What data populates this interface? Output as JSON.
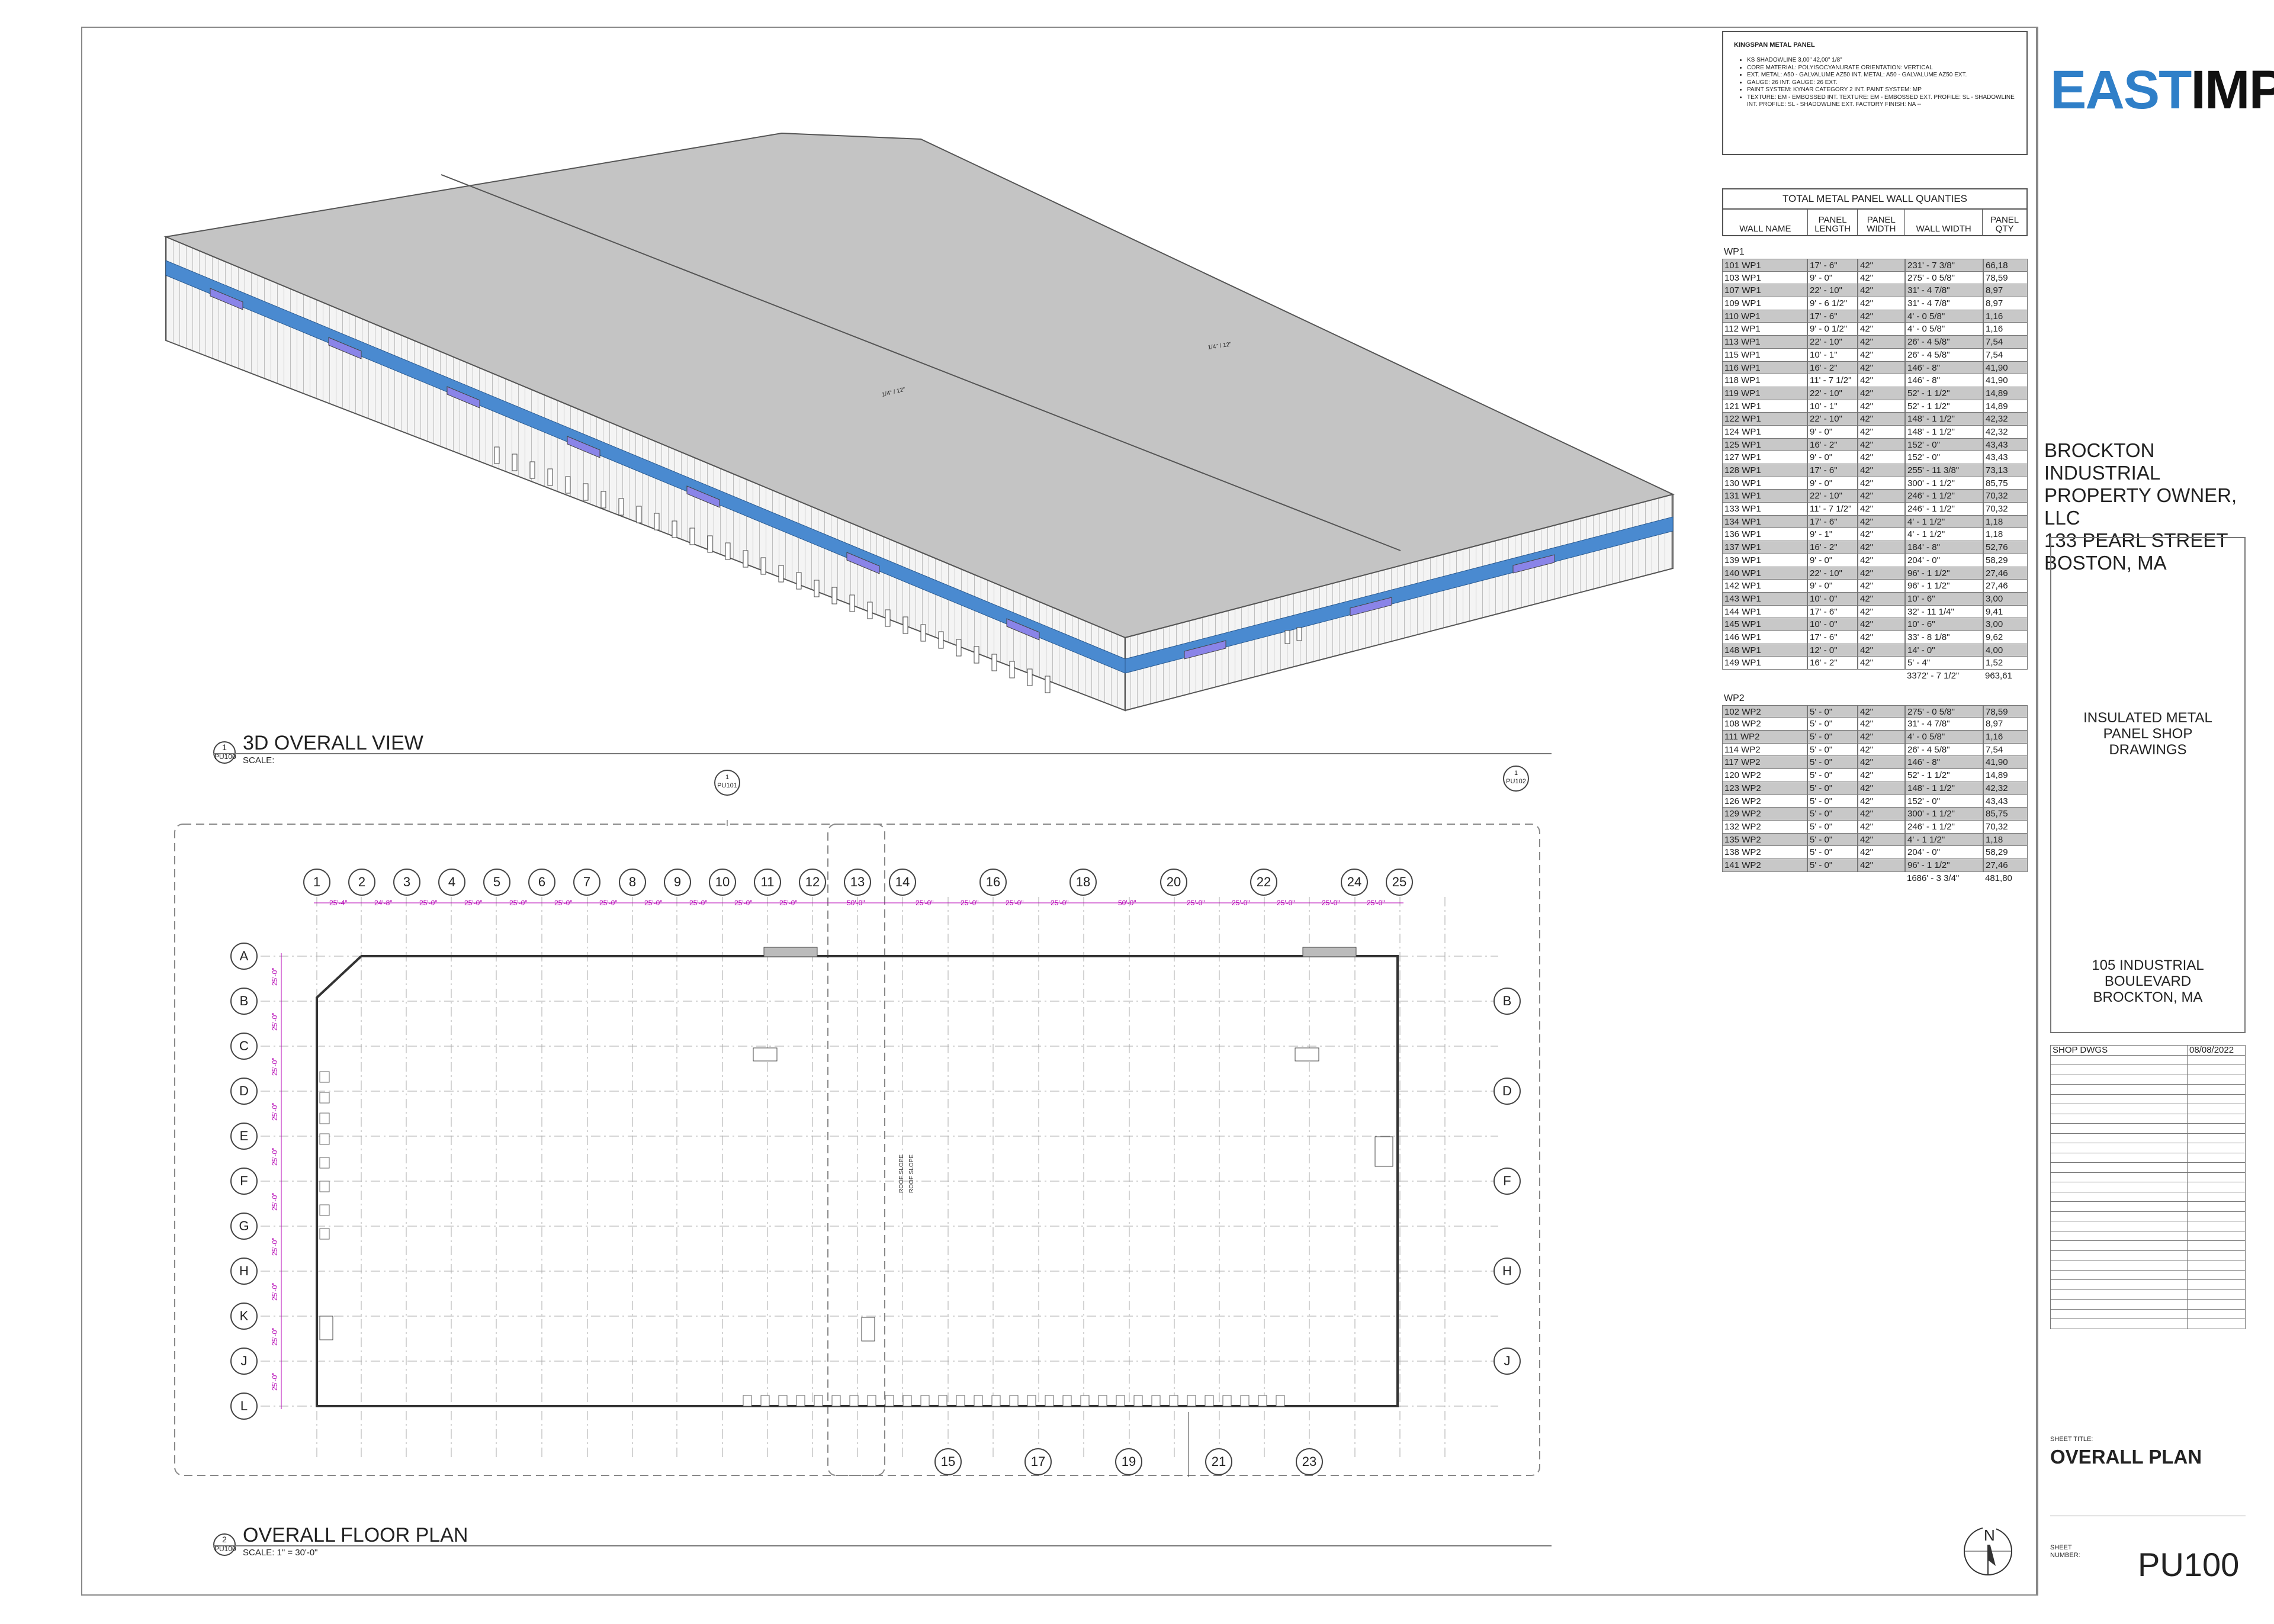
{
  "notes": {
    "title": "KINGSPAN METAL PANEL",
    "items": [
      "KS SHADOWLINE 3,00\" 42,00\" 1/8\"",
      "CORE MATERIAL: POLYISOCYANURATE ORIENTATION: VERTICAL",
      "EXT. METAL: A50 - GALVALUME AZ50 INT. METAL: A50 - GALVALUME AZ50 EXT.",
      "GAUGE: 26 INT. GAUGE: 26 EXT.",
      "PAINT SYSTEM: KYNAR CATEGORY 2 INT. PAINT SYSTEM: MP",
      "TEXTURE: EM - EMBOSSED INT. TEXTURE: EM - EMBOSSED EXT. PROFILE: SL - SHADOWLINE INT. PROFILE: SL - SHADOWLINE EXT. FACTORY FINISH: NA --"
    ]
  },
  "schedule": {
    "title": "TOTAL METAL PANEL WALL QUANTIES",
    "columns": [
      "WALL NAME",
      "PANEL LENGTH",
      "PANEL WIDTH",
      "WALL WIDTH",
      "PANEL QTY"
    ],
    "groups": [
      {
        "label": "WP1",
        "rows": [
          [
            "101 WP1",
            "17' - 6\"",
            "42\"",
            "231' - 7 3/8\"",
            "66,18"
          ],
          [
            "103 WP1",
            "9' - 0\"",
            "42\"",
            "275' - 0 5/8\"",
            "78,59"
          ],
          [
            "107 WP1",
            "22' - 10\"",
            "42\"",
            "31' - 4 7/8\"",
            "8,97"
          ],
          [
            "109 WP1",
            "9' - 6 1/2\"",
            "42\"",
            "31' - 4 7/8\"",
            "8,97"
          ],
          [
            "110 WP1",
            "17' - 6\"",
            "42\"",
            "4' - 0 5/8\"",
            "1,16"
          ],
          [
            "112 WP1",
            "9' - 0 1/2\"",
            "42\"",
            "4' - 0 5/8\"",
            "1,16"
          ],
          [
            "113 WP1",
            "22' - 10\"",
            "42\"",
            "26' - 4 5/8\"",
            "7,54"
          ],
          [
            "115 WP1",
            "10' - 1\"",
            "42\"",
            "26' - 4 5/8\"",
            "7,54"
          ],
          [
            "116 WP1",
            "16' - 2\"",
            "42\"",
            "146' - 8\"",
            "41,90"
          ],
          [
            "118 WP1",
            "11' - 7 1/2\"",
            "42\"",
            "146' - 8\"",
            "41,90"
          ],
          [
            "119 WP1",
            "22' - 10\"",
            "42\"",
            "52' - 1 1/2\"",
            "14,89"
          ],
          [
            "121 WP1",
            "10' - 1\"",
            "42\"",
            "52' - 1 1/2\"",
            "14,89"
          ],
          [
            "122 WP1",
            "22' - 10\"",
            "42\"",
            "148' - 1 1/2\"",
            "42,32"
          ],
          [
            "124 WP1",
            "9' - 0\"",
            "42\"",
            "148' - 1 1/2\"",
            "42,32"
          ],
          [
            "125 WP1",
            "16' - 2\"",
            "42\"",
            "152' - 0\"",
            "43,43"
          ],
          [
            "127 WP1",
            "9' - 0\"",
            "42\"",
            "152' - 0\"",
            "43,43"
          ],
          [
            "128 WP1",
            "17' - 6\"",
            "42\"",
            "255' - 11 3/8\"",
            "73,13"
          ],
          [
            "130 WP1",
            "9' - 0\"",
            "42\"",
            "300' - 1 1/2\"",
            "85,75"
          ],
          [
            "131 WP1",
            "22' - 10\"",
            "42\"",
            "246' - 1 1/2\"",
            "70,32"
          ],
          [
            "133 WP1",
            "11' - 7 1/2\"",
            "42\"",
            "246' - 1 1/2\"",
            "70,32"
          ],
          [
            "134 WP1",
            "17' - 6\"",
            "42\"",
            "4' - 1 1/2\"",
            "1,18"
          ],
          [
            "136 WP1",
            "9' - 1\"",
            "42\"",
            "4' - 1 1/2\"",
            "1,18"
          ],
          [
            "137 WP1",
            "16' - 2\"",
            "42\"",
            "184' - 8\"",
            "52,76"
          ],
          [
            "139 WP1",
            "9' - 0\"",
            "42\"",
            "204' - 0\"",
            "58,29"
          ],
          [
            "140 WP1",
            "22' - 10\"",
            "42\"",
            "96' - 1 1/2\"",
            "27,46"
          ],
          [
            "142 WP1",
            "9' - 0\"",
            "42\"",
            "96' - 1 1/2\"",
            "27,46"
          ],
          [
            "143 WP1",
            "10' - 0\"",
            "42\"",
            "10' - 6\"",
            "3,00"
          ],
          [
            "144 WP1",
            "17' - 6\"",
            "42\"",
            "32' - 11 1/4\"",
            "9,41"
          ],
          [
            "145 WP1",
            "10' - 0\"",
            "42\"",
            "10' - 6\"",
            "3,00"
          ],
          [
            "146 WP1",
            "17' - 6\"",
            "42\"",
            "33' - 8 1/8\"",
            "9,62"
          ],
          [
            "148 WP1",
            "12' - 0\"",
            "42\"",
            "14' - 0\"",
            "4,00"
          ],
          [
            "149 WP1",
            "16' - 2\"",
            "42\"",
            "5' - 4\"",
            "1,52"
          ]
        ],
        "total": [
          "",
          "",
          "",
          "3372' - 7 1/2\"",
          "963,61"
        ]
      },
      {
        "label": "WP2",
        "rows": [
          [
            "102 WP2",
            "5' - 0\"",
            "42\"",
            "275' - 0 5/8\"",
            "78,59"
          ],
          [
            "108 WP2",
            "5' - 0\"",
            "42\"",
            "31' - 4 7/8\"",
            "8,97"
          ],
          [
            "111 WP2",
            "5' - 0\"",
            "42\"",
            "4' - 0 5/8\"",
            "1,16"
          ],
          [
            "114 WP2",
            "5' - 0\"",
            "42\"",
            "26' - 4 5/8\"",
            "7,54"
          ],
          [
            "117 WP2",
            "5' - 0\"",
            "42\"",
            "146' - 8\"",
            "41,90"
          ],
          [
            "120 WP2",
            "5' - 0\"",
            "42\"",
            "52' - 1 1/2\"",
            "14,89"
          ],
          [
            "123 WP2",
            "5' - 0\"",
            "42\"",
            "148' - 1 1/2\"",
            "42,32"
          ],
          [
            "126 WP2",
            "5' - 0\"",
            "42\"",
            "152' - 0\"",
            "43,43"
          ],
          [
            "129 WP2",
            "5' - 0\"",
            "42\"",
            "300' - 1 1/2\"",
            "85,75"
          ],
          [
            "132 WP2",
            "5' - 0\"",
            "42\"",
            "246' - 1 1/2\"",
            "70,32"
          ],
          [
            "135 WP2",
            "5' - 0\"",
            "42\"",
            "4' - 1 1/2\"",
            "1,18"
          ],
          [
            "138 WP2",
            "5' - 0\"",
            "42\"",
            "204' - 0\"",
            "58,29"
          ],
          [
            "141 WP2",
            "5' - 0\"",
            "42\"",
            "96' - 1 1/2\"",
            "27,46"
          ]
        ],
        "total": [
          "",
          "",
          "",
          "1686' - 3 3/4\"",
          "481,80"
        ]
      }
    ]
  },
  "titleblock": {
    "logo_a": "EAST",
    "logo_b": "IMP",
    "owner": [
      "BROCKTON INDUSTRIAL",
      "PROPERTY OWNER, LLC",
      "133 PEARL STREET",
      "BOSTON, MA"
    ],
    "project": [
      "INSULATED METAL",
      "PANEL SHOP",
      "DRAWINGS"
    ],
    "address": [
      "105 INDUSTRIAL",
      "BOULEVARD",
      "BROCKTON, MA"
    ],
    "rev_first": [
      "SHOP DWGS",
      "08/08/2022"
    ],
    "sheet_title_label": "SHEET TITLE:",
    "sheet_title": "OVERALL PLAN",
    "sheet_number_label": "SHEET NUMBER:",
    "sheet_number": "PU100"
  },
  "view3d": {
    "num": "1",
    "sheet": "PU100",
    "title": "3D OVERALL VIEW",
    "scale": "SCALE:",
    "slope_1": "1/4\" / 12\"",
    "slope_2": "1/4\" / 12\""
  },
  "plan": {
    "num": "2",
    "sheet": "PU100",
    "title": "OVERALL FLOOR PLAN",
    "scale": "SCALE: 1\" = 30'-0\"",
    "callout_num": "1",
    "callout_a": "PU101",
    "callout_b": "PU102",
    "top_grids": [
      "1",
      "2",
      "3",
      "4",
      "5",
      "6",
      "7",
      "8",
      "9",
      "10",
      "11",
      "12",
      "13",
      "14",
      "16",
      "18",
      "20",
      "22",
      "24",
      "25"
    ],
    "bottom_grids": [
      "15",
      "17",
      "19",
      "21",
      "23"
    ],
    "left_grids": [
      "A",
      "B",
      "C",
      "D",
      "E",
      "F",
      "G",
      "H",
      "K",
      "J",
      "L"
    ],
    "right_grids": [
      "B",
      "D",
      "F",
      "H",
      "J"
    ],
    "top_dims": [
      "25'-4\"",
      "24'-8\"",
      "25'-0\"",
      "25'-0\"",
      "25'-0\"",
      "25'-0\"",
      "25'-0\"",
      "25'-0\"",
      "25'-0\"",
      "25'-0\"",
      "25'-0\"",
      "50'-0\"",
      "25'-0\"",
      "25'-0\"",
      "25'-0\"",
      "25'-0\"",
      "50'-0\"",
      "25'-0\"",
      "25'-0\"",
      "25'-0\"",
      "25'-0\"",
      "25'-0\""
    ],
    "left_dim": "25'-0\"",
    "roof_slope": "ROOF SLOPE",
    "north": "N"
  }
}
